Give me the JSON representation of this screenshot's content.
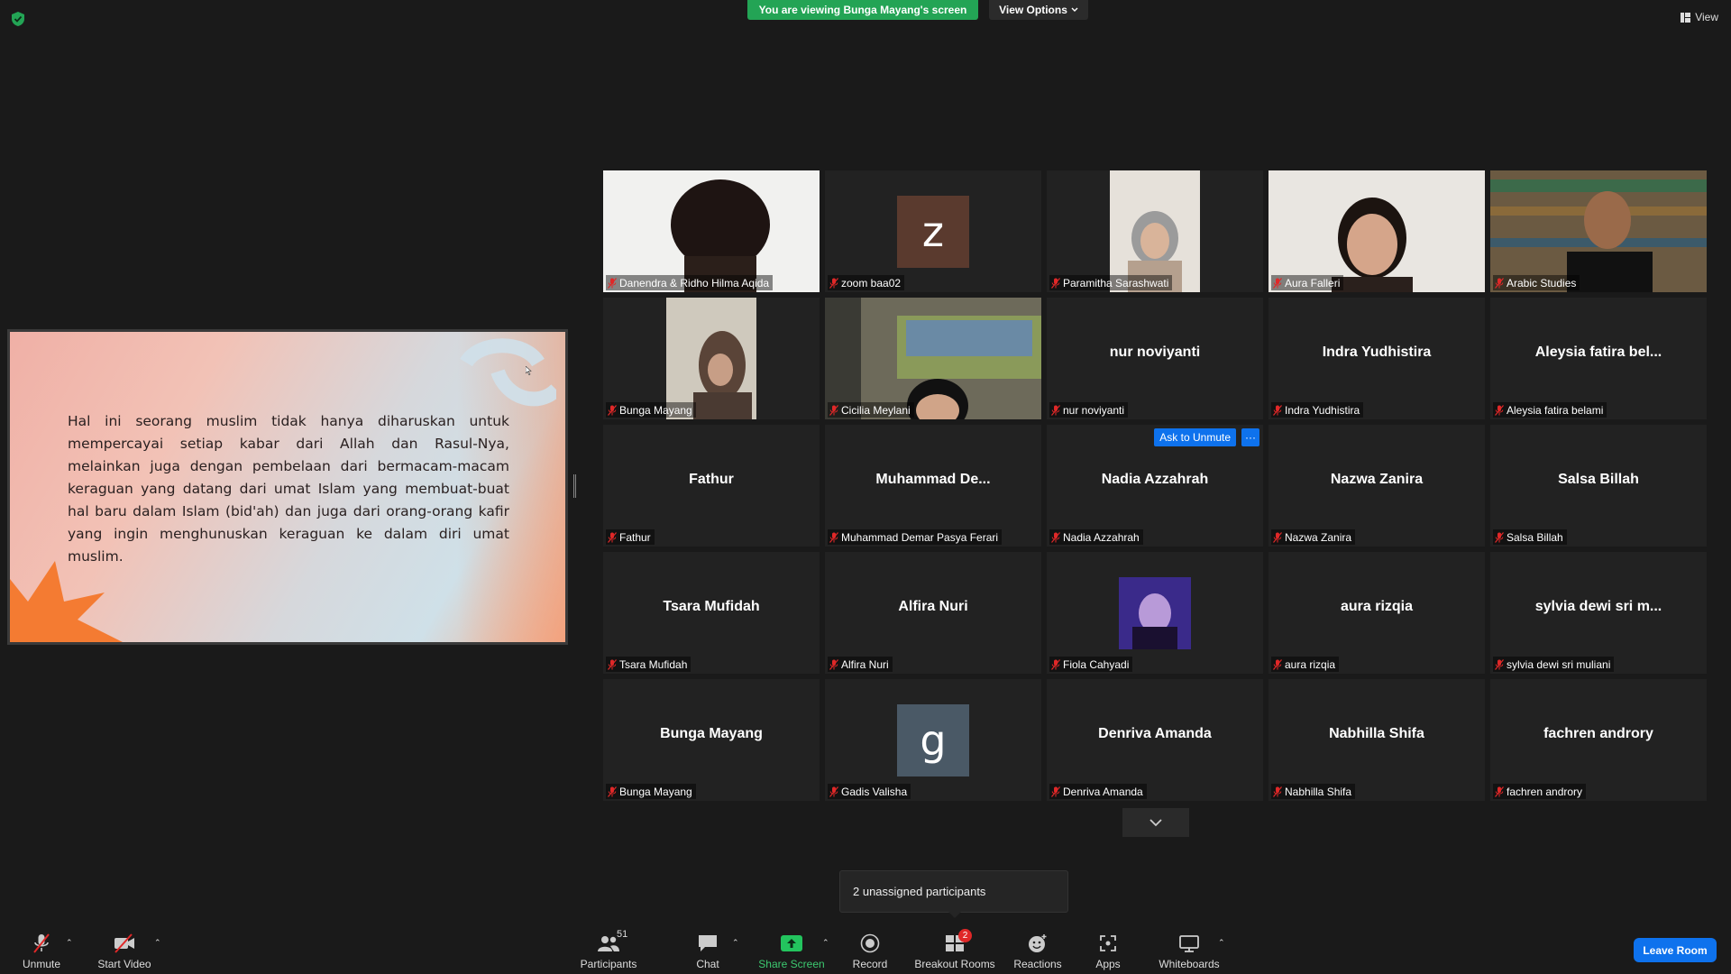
{
  "top": {
    "viewing_banner": "You are viewing Bunga Mayang's screen",
    "view_options": "View Options",
    "view_label": "View"
  },
  "slide": {
    "text": "Hal ini seorang muslim tidak hanya diharuskan untuk mempercayai setiap kabar dari Allah dan Rasul-Nya, melainkan juga dengan pembelaan dari bermacam-macam keraguan yang datang dari umat Islam yang membuat-buat hal baru dalam Islam (bid'ah) dan juga dari orang-orang kafir yang ingin menghunuskan keraguan ke dalam diri umat muslim."
  },
  "participants": [
    {
      "display": "",
      "name": "Danendra & Ridho Hilma Aqida",
      "kind": "video"
    },
    {
      "display": "z",
      "name": "zoom baa02",
      "kind": "avatar",
      "avatar_color": "#5a3a2e"
    },
    {
      "display": "",
      "name": "Paramitha Sarashwati",
      "kind": "video"
    },
    {
      "display": "",
      "name": "Aura Falleri",
      "kind": "video"
    },
    {
      "display": "",
      "name": "Arabic Studies",
      "kind": "video"
    },
    {
      "display": "",
      "name": "Bunga Mayang",
      "kind": "video"
    },
    {
      "display": "",
      "name": "Cicilia Meylani",
      "kind": "video",
      "active": true
    },
    {
      "display": "nur noviyanti",
      "name": "nur noviyanti",
      "kind": "name"
    },
    {
      "display": "Indra Yudhistira",
      "name": "Indra Yudhistira",
      "kind": "name"
    },
    {
      "display": "Aleysia fatira bel...",
      "name": "Aleysia fatira belami",
      "kind": "name"
    },
    {
      "display": "Fathur",
      "name": "Fathur",
      "kind": "name"
    },
    {
      "display": "Muhammad  De...",
      "name": "Muhammad Demar Pasya Ferari",
      "kind": "name"
    },
    {
      "display": "Nadia Azzahrah",
      "name": "Nadia Azzahrah",
      "kind": "name",
      "hover": true
    },
    {
      "display": "Nazwa Zanira",
      "name": "Nazwa Zanira",
      "kind": "name"
    },
    {
      "display": "Salsa Billah",
      "name": "Salsa Billah",
      "kind": "name"
    },
    {
      "display": "Tsara Mufidah",
      "name": "Tsara Mufidah",
      "kind": "name"
    },
    {
      "display": "Alfira Nuri",
      "name": "Alfira Nuri",
      "kind": "name"
    },
    {
      "display": "",
      "name": "Fiola Cahyadi",
      "kind": "video"
    },
    {
      "display": "aura rizqia",
      "name": "aura rizqia",
      "kind": "name"
    },
    {
      "display": "sylvia dewi sri m...",
      "name": "sylvia dewi sri muliani",
      "kind": "name"
    },
    {
      "display": "Bunga Mayang",
      "name": "Bunga Mayang",
      "kind": "name"
    },
    {
      "display": "g",
      "name": "Gadis Valisha",
      "kind": "avatar",
      "avatar_color": "#4a5966"
    },
    {
      "display": "Denriva Amanda",
      "name": "Denriva Amanda",
      "kind": "name"
    },
    {
      "display": "Nabhilla Shifa",
      "name": "Nabhilla Shifa",
      "kind": "name"
    },
    {
      "display": "fachren androry",
      "name": "fachren androry",
      "kind": "name"
    }
  ],
  "hover_actions": {
    "ask_to_unmute": "Ask to Unmute",
    "more": "···"
  },
  "tooltip": "2 unassigned participants",
  "toolbar": {
    "unmute": "Unmute",
    "start_video": "Start Video",
    "participants": "Participants",
    "participants_count": "51",
    "chat": "Chat",
    "share_screen": "Share Screen",
    "record": "Record",
    "breakout_rooms": "Breakout Rooms",
    "breakout_badge": "2",
    "reactions": "Reactions",
    "apps": "Apps",
    "whiteboards": "Whiteboards",
    "leave_room": "Leave Room"
  },
  "colors": {
    "banner_green": "#23a455",
    "accent_blue": "#0e72ed",
    "active_speaker": "#e8e85a",
    "muted_red": "#e02828"
  }
}
